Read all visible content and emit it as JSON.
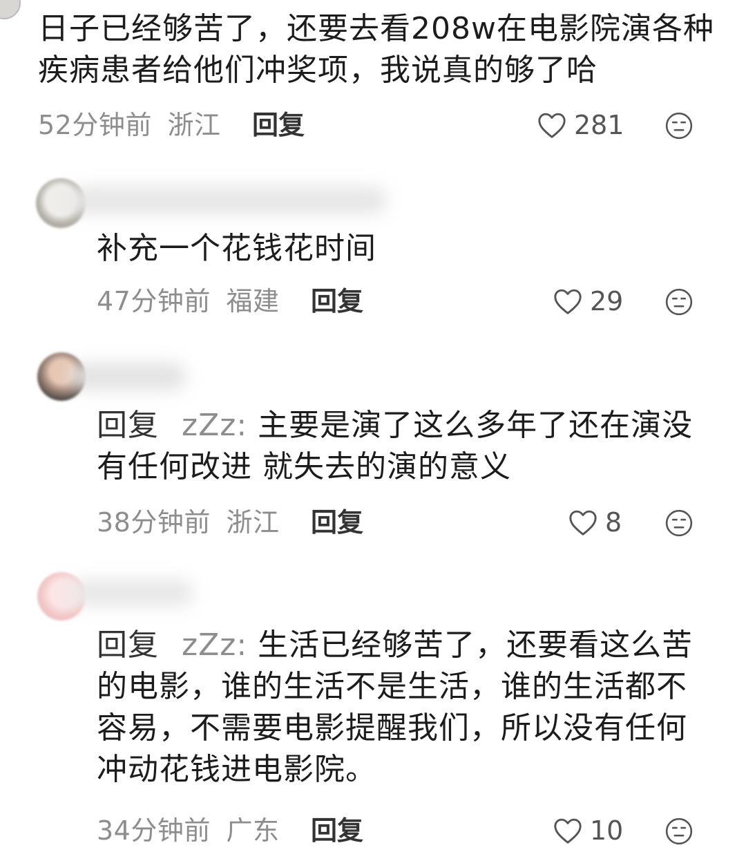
{
  "comments": [
    {
      "text": "日子已经够苦了，还要去看208w在电影院演各种疾病患者给他们冲奖项，我说真的够了哈",
      "time": "52分钟前",
      "region": "浙江",
      "reply_label": "回复",
      "likes": "281"
    },
    {
      "text": "补充一个花钱花时间",
      "time": "47分钟前",
      "region": "福建",
      "reply_label": "回复",
      "likes": "29"
    },
    {
      "reply_prefix": "回复",
      "reply_to": "zZz",
      "separator": ":",
      "text": "主要是演了这么多年了还在演没有任何改进 就失去的演的意义",
      "time": "38分钟前",
      "region": "浙江",
      "reply_label": "回复",
      "likes": "8"
    },
    {
      "reply_prefix": "回复",
      "reply_to": "zZz",
      "separator": ":",
      "text": "生活已经够苦了，还要看这么苦的电影，谁的生活不是生活，谁的生活都不容易，不需要电影提醒我们，所以没有任何冲动花钱进电影院。",
      "time": "34分钟前",
      "region": "广东",
      "reply_label": "回复",
      "likes": "10"
    }
  ],
  "colors": {
    "text": "#1c1c1c",
    "meta": "#8d8d8d",
    "icon": "#555555"
  },
  "icons": [
    "heart-outline-icon",
    "dislike-face-icon"
  ]
}
